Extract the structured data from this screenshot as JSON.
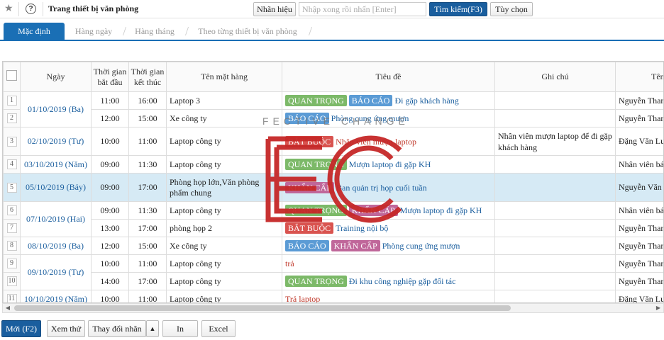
{
  "toolbar": {
    "title": "Trang thiết bị văn phòng",
    "label_button": "Nhãn hiệu",
    "search_placeholder": "Nhập xong rồi nhấn [Enter]",
    "search_button": "Tìm kiếm(F3)",
    "options_button": "Tùy chọn"
  },
  "tabs": [
    {
      "label": "Mặc định",
      "active": true
    },
    {
      "label": "Hàng ngày",
      "active": false
    },
    {
      "label": "Hàng tháng",
      "active": false
    },
    {
      "label": "Theo từng thiết bị văn phòng",
      "active": false
    }
  ],
  "table": {
    "headers": {
      "date": "Ngày",
      "start": "Thời gian bắt đầu",
      "end": "Thời gian kết thúc",
      "item": "Tên mặt hàng",
      "title": "Tiêu đề",
      "note": "Ghi chú",
      "name": "Tên n"
    },
    "rows": [
      {
        "no": "1",
        "date": "01/10/2019 (Ba)",
        "start": "11:00",
        "end": "16:00",
        "item": "Laptop 3",
        "badges": [
          "QUAN TRỌNG",
          "BÁO CÁO"
        ],
        "title": "Đi gặp khách hàng",
        "note": "",
        "name": "Nguyễn Thanh"
      },
      {
        "no": "2",
        "date": "",
        "start": "12:00",
        "end": "15:00",
        "item": "Xe công ty",
        "badges": [
          "BÁO CÁO"
        ],
        "title": "Phòng cung ứng mượn",
        "note": "",
        "name": "Nguyễn Thanh"
      },
      {
        "no": "3",
        "date": "02/10/2019 (Tư)",
        "start": "10:00",
        "end": "11:00",
        "item": "Laptop công ty",
        "badges": [
          "BẮT BUỘC"
        ],
        "title": "Nhân viên mượn laptop",
        "note": "Nhân viên mượn laptop để đi gặp khách hàng",
        "name": "Đặng Văn Lu"
      },
      {
        "no": "4",
        "date": "03/10/2019 (Năm)",
        "start": "09:00",
        "end": "11:30",
        "item": "Laptop công ty",
        "badges": [
          "QUAN TRỌNG"
        ],
        "title": "Mượn laptop đi gặp KH",
        "note": "",
        "name": "Nhân viên bán"
      },
      {
        "no": "5",
        "date": "05/10/2019 (Bảy)",
        "start": "09:00",
        "end": "17:00",
        "item": "Phòng họp lớn,Văn phòng phẩm chung",
        "badges": [
          "KHẨN CẤP"
        ],
        "title": "Ban quản trị họp cuối tuần",
        "note": "",
        "name": "Nguyễn Văn A"
      },
      {
        "no": "6",
        "date": "07/10/2019 (Hai)",
        "start": "09:00",
        "end": "11:30",
        "item": "Laptop công ty",
        "badges": [
          "QUAN TRỌNG",
          "KHẨN CẤP"
        ],
        "title": "Mượn laptop đi gặp KH",
        "note": "",
        "name": "Nhân viên bán"
      },
      {
        "no": "7",
        "date": "",
        "start": "13:00",
        "end": "17:00",
        "item": "phòng họp 2",
        "badges": [
          "BẮT BUỘC"
        ],
        "title": "Training nội bộ",
        "note": "",
        "name": "Nguyễn Thanh"
      },
      {
        "no": "8",
        "date": "08/10/2019 (Ba)",
        "start": "12:00",
        "end": "15:00",
        "item": "Xe công ty",
        "badges": [
          "BÁO CÁO",
          "KHẨN CẤP"
        ],
        "title": "Phòng cung ứng mượn",
        "note": "",
        "name": "Nguyễn Thanh"
      },
      {
        "no": "9",
        "date": "09/10/2019 (Tư)",
        "start": "10:00",
        "end": "11:00",
        "item": "Laptop công ty",
        "badges": [],
        "title": "trả",
        "note": "",
        "name": "Nguyễn Thanh"
      },
      {
        "no": "10",
        "date": "",
        "start": "14:00",
        "end": "17:00",
        "item": "Laptop công ty",
        "badges": [
          "QUAN TRỌNG"
        ],
        "title": "Đi khu công nghiệp gặp đối tác",
        "note": "",
        "name": "Nguyễn Thanh"
      },
      {
        "no": "11",
        "date": "10/10/2019 (Năm)",
        "start": "10:00",
        "end": "11:00",
        "item": "Laptop công ty",
        "badges": [],
        "title": "Trả laptop",
        "note": "",
        "name": "Đặng Văn Lu"
      }
    ]
  },
  "watermark": {
    "text": "EFFECTIVE CHANGE",
    "letters": "EC"
  },
  "footer": {
    "new_button": "Mới (F2)",
    "preview_button": "Xem thử",
    "change_button": "Thay đổi nhãn",
    "print_button": "In",
    "excel_button": "Excel"
  },
  "colors": {
    "accent": "#1a6fb5",
    "badge_quan_trong": "#7cb968",
    "badge_bao_cao": "#5b9bd5",
    "badge_bat_buoc": "#d9534f",
    "badge_khan_cap": "#c0679a",
    "watermark": "#c62828"
  }
}
